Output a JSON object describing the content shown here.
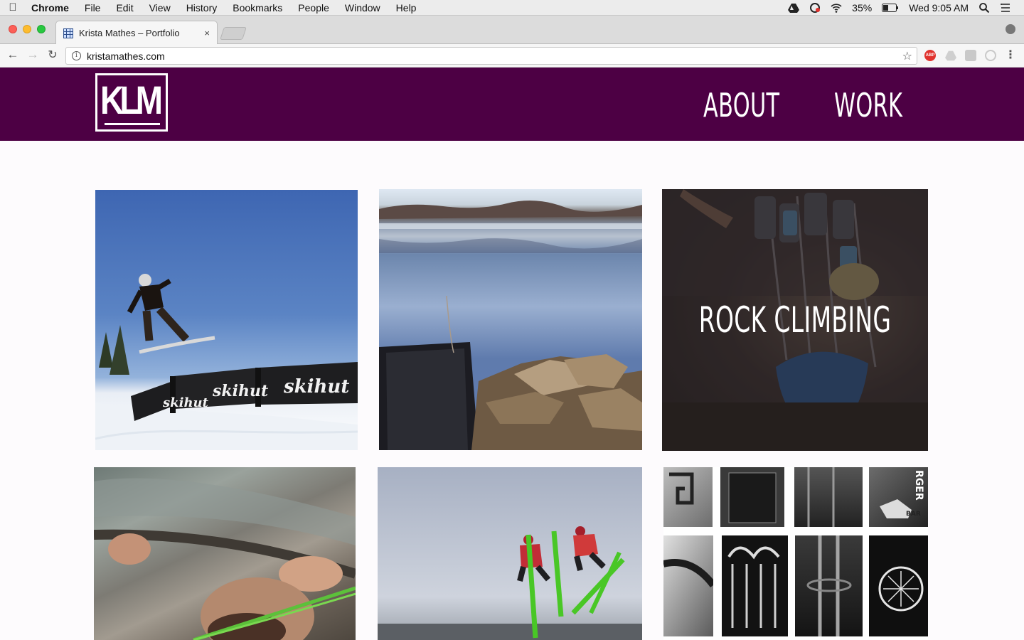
{
  "menubar": {
    "app_name": "Chrome",
    "items": [
      "File",
      "Edit",
      "View",
      "History",
      "Bookmarks",
      "People",
      "Window",
      "Help"
    ],
    "battery": "35%",
    "clock": "Wed 9:05 AM"
  },
  "browser": {
    "tab_title": "Krista Mathes – Portfolio",
    "tab_close": "×",
    "url": "kristamathes.com",
    "back_icon": "arrow-left-icon",
    "forward_icon": "arrow-right-icon",
    "reload_icon": "reload-icon",
    "bookmark_icon": "star-icon",
    "extensions": [
      "adblock-icon",
      "drive-icon",
      "extension-icon",
      "search-extension-icon"
    ],
    "menu_icon": "kebab-menu-icon"
  },
  "site": {
    "header_bg": "#4d0044",
    "logo_text": "KLM",
    "nav": {
      "about": "ABOUT",
      "work": "WORK"
    }
  },
  "gallery": {
    "tiles": [
      {
        "id": "snowboard",
        "subject": "snowboarder jumping over rail"
      },
      {
        "id": "lake",
        "subject": "lake reflection with rocks"
      },
      {
        "id": "rock-climbing",
        "subject": "climbing gear",
        "title": "ROCK CLIMBING"
      },
      {
        "id": "crack-climb",
        "subject": "climber hands in rock crack"
      },
      {
        "id": "skiers",
        "subject": "two skiers mid-air"
      },
      {
        "id": "urban-bw",
        "subject": "black and white architecture grid"
      }
    ],
    "sign_texts": [
      "skihut",
      "skihut",
      "skihut"
    ],
    "burger_sign": "RGER",
    "bar_sign": "BAR"
  }
}
